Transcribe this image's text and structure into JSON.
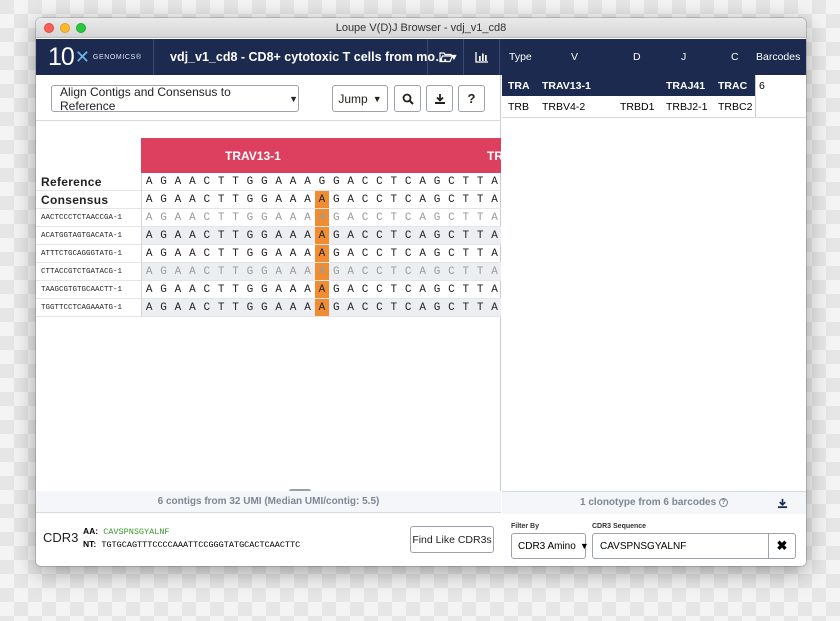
{
  "window": {
    "title": "Loupe V(D)J Browser - vdj_v1_cd8"
  },
  "logo": {
    "mark": "10",
    "brand": "GENOMICS",
    "trademark": "®"
  },
  "dataset": {
    "selected": "vdj_v1_cd8 - CD8+ cytotoxic T cells from mo…"
  },
  "icons": {
    "open": "folder-open-icon",
    "stats": "bar-chart-icon",
    "search": "search-icon",
    "download": "download-icon",
    "help": "help-icon",
    "clear": "close-icon"
  },
  "toolbar": {
    "align_mode": "Align Contigs and Consensus to Reference",
    "jump_label": "Jump",
    "help_label": "?"
  },
  "alignment": {
    "gene_label": "TRAV13-1",
    "gene_label_next": "TR",
    "highlight_col": 12,
    "rows": [
      {
        "name": "Reference",
        "kind": "big",
        "seq": [
          "A",
          "G",
          "A",
          "A",
          "C",
          "T",
          "T",
          "G",
          "G",
          "A",
          "A",
          "A",
          "G",
          "G",
          "A",
          "C",
          "C",
          "T",
          "C",
          "A",
          "G",
          "C",
          "T",
          "T",
          "A",
          "T"
        ]
      },
      {
        "name": "Consensus",
        "kind": "big",
        "seq": [
          "A",
          "G",
          "A",
          "A",
          "C",
          "T",
          "T",
          "G",
          "G",
          "A",
          "A",
          "A",
          "A",
          "G",
          "A",
          "C",
          "C",
          "T",
          "C",
          "A",
          "G",
          "C",
          "T",
          "T",
          "A",
          "T"
        ]
      },
      {
        "name": "AACTCCCTCTAACCGA-1",
        "kind": "small",
        "faint": true,
        "seq": [
          "A",
          "G",
          "A",
          "A",
          "C",
          "T",
          "T",
          "G",
          "G",
          "A",
          "A",
          "A",
          "A",
          "G",
          "A",
          "C",
          "C",
          "T",
          "C",
          "A",
          "G",
          "C",
          "T",
          "T",
          "A",
          "T"
        ]
      },
      {
        "name": "ACATGGTAGTGACATA-1",
        "kind": "small",
        "faint": false,
        "seq": [
          "A",
          "G",
          "A",
          "A",
          "C",
          "T",
          "T",
          "G",
          "G",
          "A",
          "A",
          "A",
          "A",
          "G",
          "A",
          "C",
          "C",
          "T",
          "C",
          "A",
          "G",
          "C",
          "T",
          "T",
          "A",
          "T"
        ]
      },
      {
        "name": "ATTTCTGCAGGGTATG-1",
        "kind": "small",
        "faint": false,
        "seq": [
          "A",
          "G",
          "A",
          "A",
          "C",
          "T",
          "T",
          "G",
          "G",
          "A",
          "A",
          "A",
          "A",
          "G",
          "A",
          "C",
          "C",
          "T",
          "C",
          "A",
          "G",
          "C",
          "T",
          "T",
          "A",
          "T"
        ]
      },
      {
        "name": "CTTACCGTCTGATACG-1",
        "kind": "small",
        "faint": true,
        "seq": [
          "A",
          "G",
          "A",
          "A",
          "C",
          "T",
          "T",
          "G",
          "G",
          "A",
          "A",
          "A",
          "A",
          "G",
          "A",
          "C",
          "C",
          "T",
          "C",
          "A",
          "G",
          "C",
          "T",
          "T",
          "A",
          "T"
        ]
      },
      {
        "name": "TAAGCGTGTGCAACTT-1",
        "kind": "small",
        "faint": false,
        "seq": [
          "A",
          "G",
          "A",
          "A",
          "C",
          "T",
          "T",
          "G",
          "G",
          "A",
          "A",
          "A",
          "A",
          "G",
          "A",
          "C",
          "C",
          "T",
          "C",
          "A",
          "G",
          "C",
          "T",
          "T",
          "A",
          "T"
        ]
      },
      {
        "name": "TGGTTCCTCAGAAATG-1",
        "kind": "small",
        "faint": false,
        "seq": [
          "A",
          "G",
          "A",
          "A",
          "C",
          "T",
          "T",
          "G",
          "G",
          "A",
          "A",
          "A",
          "A",
          "G",
          "A",
          "C",
          "C",
          "T",
          "C",
          "A",
          "G",
          "C",
          "T",
          "T",
          "A",
          "T"
        ]
      }
    ]
  },
  "left_status": "6 contigs from 32 UMI (Median UMI/contig: 5.5)",
  "cdr3": {
    "label": "CDR3",
    "aa_label": "AA:",
    "aa": "CAVSPNSGYALNF",
    "nt_label": "NT:",
    "nt": "TGTGCAGTTTCCCCAAATTCCGGGTATGCACTCAACTTC",
    "find_button": "Find Like CDR3s"
  },
  "clonotypes": {
    "headers": [
      "Type",
      "V",
      "D",
      "J",
      "C",
      "Barcodes"
    ],
    "rows": [
      {
        "type": "TRA",
        "v": "TRAV13-1",
        "d": "",
        "j": "TRAJ41",
        "c": "TRAC",
        "selected": true
      },
      {
        "type": "TRB",
        "v": "TRBV4-2",
        "d": "TRBD1",
        "j": "TRBJ2-1",
        "c": "TRBC2",
        "selected": false
      }
    ],
    "barcodes": "6"
  },
  "right_status": "1 clonotype from 6 barcodes",
  "filter": {
    "filter_by_label": "Filter By",
    "filter_by_value": "CDR3 Amino",
    "seq_label": "CDR3 Sequence",
    "seq_value": "CAVSPNSGYALNF"
  },
  "colors": {
    "navy": "#1c2a4f",
    "gene_bar": "#dd3f5e",
    "highlight": "#f08c32",
    "aa_green": "#3a9a2e"
  }
}
